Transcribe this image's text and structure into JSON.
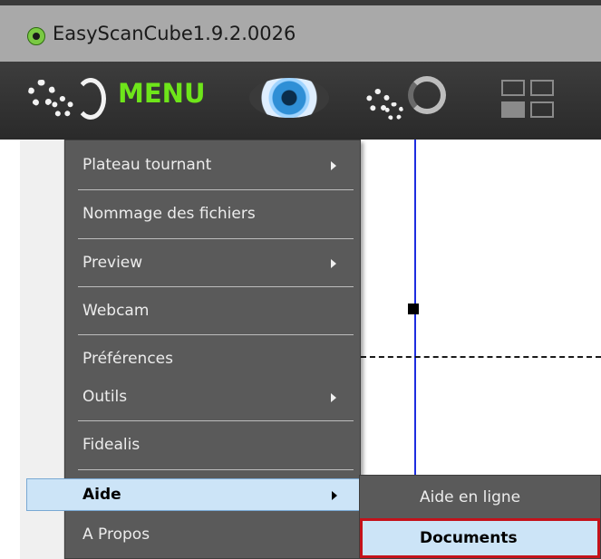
{
  "window": {
    "title": "EasyScanCube1.9.2.0026"
  },
  "toolbar": {
    "menu_label": "MENU",
    "icons": [
      "gears-refresh-icon",
      "eye-icon",
      "gears-ring-icon",
      "layout-grid-icon"
    ]
  },
  "menu": {
    "items": [
      {
        "label": "Plateau tournant",
        "has_submenu": true
      },
      {
        "label": "Nommage des fichiers",
        "has_submenu": false
      },
      {
        "label": "Preview",
        "has_submenu": true
      },
      {
        "label": "Webcam",
        "has_submenu": false
      },
      {
        "label": "Préférences",
        "has_submenu": false
      },
      {
        "label": "Outils",
        "has_submenu": true
      },
      {
        "label": "Fidealis",
        "has_submenu": false
      },
      {
        "label": "Aide",
        "has_submenu": true,
        "active": true
      },
      {
        "label": "A Propos",
        "has_submenu": false
      }
    ]
  },
  "submenu": {
    "items": [
      {
        "label": "Aide en ligne"
      },
      {
        "label": "Documents",
        "highlighted": true
      }
    ]
  },
  "colors": {
    "accent_green": "#6ee51a",
    "menu_bg": "#5a5a5a",
    "highlight_bg": "#cce4f7",
    "highlight_border": "#c4121a",
    "guide_line": "#1d2de0"
  }
}
